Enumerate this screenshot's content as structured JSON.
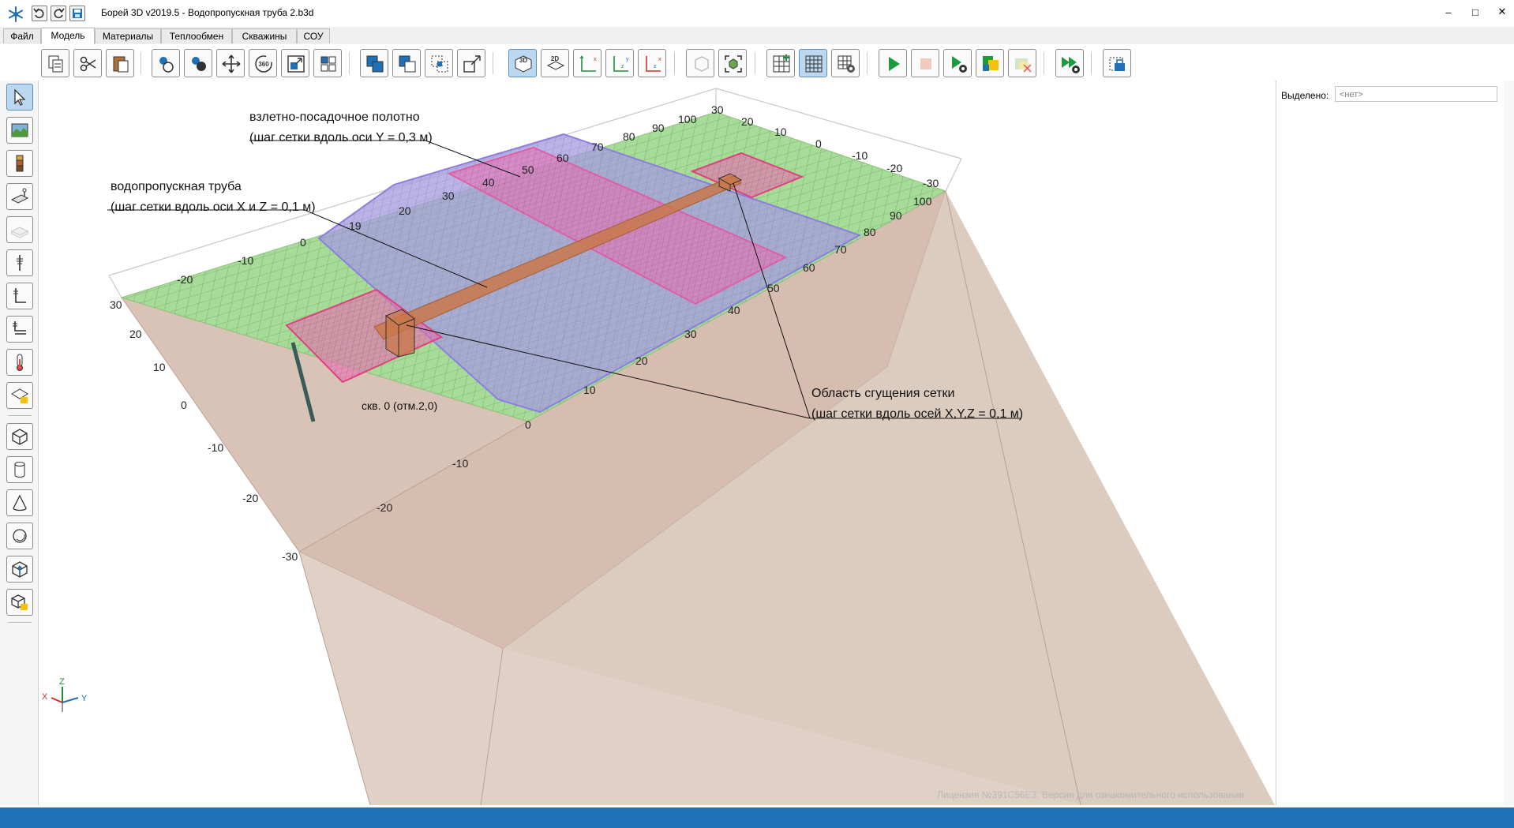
{
  "window": {
    "title": "Борей 3D v2019.5 -  Водопропускная труба 2.b3d",
    "minimize": "–",
    "maximize": "□",
    "close": "✕"
  },
  "menu_tabs": [
    "Файл",
    "Модель",
    "Материалы",
    "Теплообмен",
    "Скважины",
    "СОУ"
  ],
  "active_tab": "Модель",
  "toolbar": {
    "view3d_label": "3D",
    "view2d_label": "2D"
  },
  "right_panel": {
    "selected_label": "Выделено:",
    "selected_value": "<нет>"
  },
  "annotations": {
    "runway_line1": "взлетно-посадочное полотно",
    "runway_line2": "(шаг сетки вдоль оси Y = 0,3 м)",
    "culvert_line1": "водопропускная труба",
    "culvert_line2": "(шаг сетки вдоль оси X и Z = 0,1 м)",
    "refine_line1": "Область сгущения сетки",
    "refine_line2": "(шаг сетки вдоль осей X,Y,Z = 0,1 м)",
    "well_label": "скв. 0 (отм.2,0)"
  },
  "axes": {
    "x_label": "X",
    "y_label": "Y",
    "z_label": "Z"
  },
  "ticks": {
    "left_vertical": [
      "30",
      "20",
      "10",
      "0",
      "-10",
      "-20",
      "-30"
    ],
    "front_bottom": [
      "0",
      "-10",
      "-20"
    ],
    "left_depth": [
      "-10",
      "-20"
    ],
    "front_depth": [
      "0",
      "10",
      "19",
      "20",
      "30",
      "40",
      "50",
      "60",
      "70",
      "80",
      "90",
      "100"
    ],
    "right_depth": [
      "10",
      "20",
      "30",
      "40",
      "50",
      "60",
      "70",
      "80",
      "90",
      "100"
    ],
    "back_ruler": [
      "30",
      "20",
      "10",
      "0",
      "-10",
      "-20",
      "-30"
    ]
  },
  "license": "Лицензия №391C56E3. Версия для ознакомительного использования.",
  "colors": {
    "ground": "#9fd88f",
    "soil": "#d8c3b6",
    "runway_fill": "#a89dde",
    "refine_fill": "#e86fb0",
    "pipe": "#c9784a",
    "accent": "#1f70b7"
  }
}
